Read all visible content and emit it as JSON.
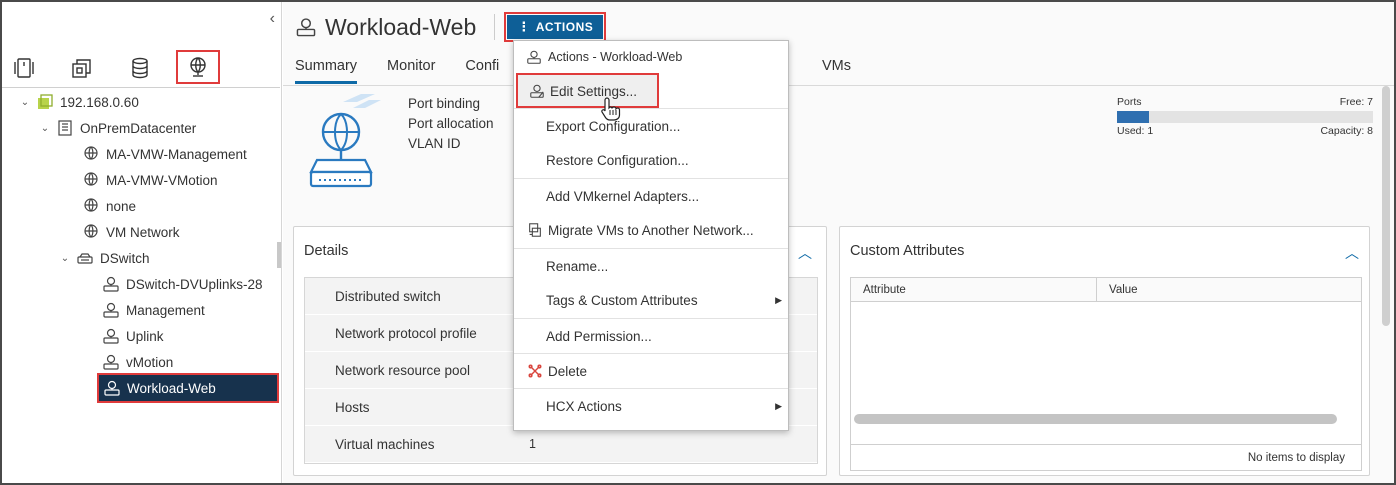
{
  "sidebar": {
    "collapse_glyph": "‹",
    "nav_icons": [
      "hosts-clusters-icon",
      "vms-templates-icon",
      "storage-icon",
      "networking-icon"
    ],
    "tree": [
      {
        "label": "192.168.0.60",
        "icon": "vcenter-icon"
      },
      {
        "label": "OnPremDatacenter",
        "icon": "datacenter-icon"
      },
      {
        "label": "MA-VMW-Management",
        "icon": "network-icon"
      },
      {
        "label": "MA-VMW-VMotion",
        "icon": "network-icon"
      },
      {
        "label": "none",
        "icon": "network-icon"
      },
      {
        "label": "VM Network",
        "icon": "network-icon"
      },
      {
        "label": "DSwitch",
        "icon": "dswitch-icon"
      },
      {
        "label": "DSwitch-DVUplinks-28",
        "icon": "portgroup-icon"
      },
      {
        "label": "Management",
        "icon": "portgroup-icon"
      },
      {
        "label": "Uplink",
        "icon": "portgroup-icon"
      },
      {
        "label": "vMotion",
        "icon": "portgroup-icon"
      },
      {
        "label": "Workload-Web",
        "icon": "portgroup-icon"
      }
    ]
  },
  "header": {
    "title": "Workload-Web",
    "actions_label": "ACTIONS",
    "tabs": [
      "Summary",
      "Monitor",
      "Confi"
    ],
    "tab_vms": "VMs"
  },
  "summary": {
    "props": [
      "Port binding",
      "Port allocation",
      "VLAN ID"
    ],
    "ports": {
      "label": "Ports",
      "free": "Free: 7",
      "used": "Used: 1",
      "capacity": "Capacity: 8",
      "used_fraction": 0.125
    }
  },
  "details": {
    "title": "Details",
    "rows": [
      {
        "label": "Distributed switch",
        "value": ""
      },
      {
        "label": "Network protocol profile",
        "value": ""
      },
      {
        "label": "Network resource pool",
        "value": ""
      },
      {
        "label": "Hosts",
        "value": ""
      },
      {
        "label": "Virtual machines",
        "value": "1"
      }
    ]
  },
  "custom_attributes": {
    "title": "Custom Attributes",
    "col_attribute": "Attribute",
    "col_value": "Value",
    "empty": "No items to display"
  },
  "menu": {
    "header": "Actions - Workload-Web",
    "items": [
      {
        "label": "Edit Settings...",
        "icon": "edit-settings-icon"
      },
      {
        "label": "Export Configuration..."
      },
      {
        "label": "Restore Configuration..."
      },
      {
        "label": "Add VMkernel Adapters..."
      },
      {
        "label": "Migrate VMs to Another Network...",
        "icon": "migrate-icon"
      },
      {
        "label": "Rename..."
      },
      {
        "label": "Tags & Custom Attributes",
        "submenu": true
      },
      {
        "label": "Add Permission..."
      },
      {
        "label": "Delete",
        "icon": "delete-icon"
      },
      {
        "label": "HCX Actions",
        "submenu": true
      }
    ]
  },
  "colors": {
    "accent": "#0e5f97",
    "highlight_border": "#e03b3b",
    "selected_bg": "#17324d"
  }
}
